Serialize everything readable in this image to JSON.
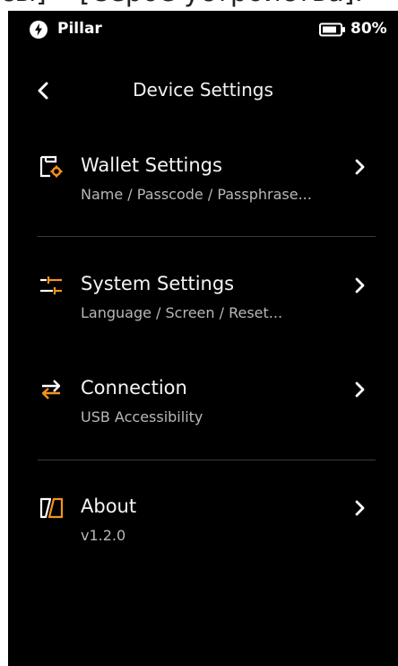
{
  "top_strip_text": "сы] • [Серое устройства].",
  "status_bar": {
    "brand_name": "Pillar",
    "battery": "80%"
  },
  "header": {
    "title": "Device Settings"
  },
  "menu": [
    {
      "label": "Wallet Settings",
      "subtitle": "Name / Passcode / Passphrase...",
      "icon": "wallet-gear-icon"
    },
    {
      "label": "System Settings",
      "subtitle": "Language / Screen / Reset...",
      "icon": "sliders-icon"
    },
    {
      "label": "Connection",
      "subtitle": "USB Accessibility",
      "icon": "transfer-arrows-icon"
    },
    {
      "label": "About",
      "subtitle": "v1.2.0",
      "icon": "logo-slash-icon"
    }
  ],
  "colors": {
    "background": "#000000",
    "accent": "#f7931a",
    "text": "#f5f5f5",
    "subtext": "#b8b8b8",
    "divider": "#3a3a3a"
  }
}
